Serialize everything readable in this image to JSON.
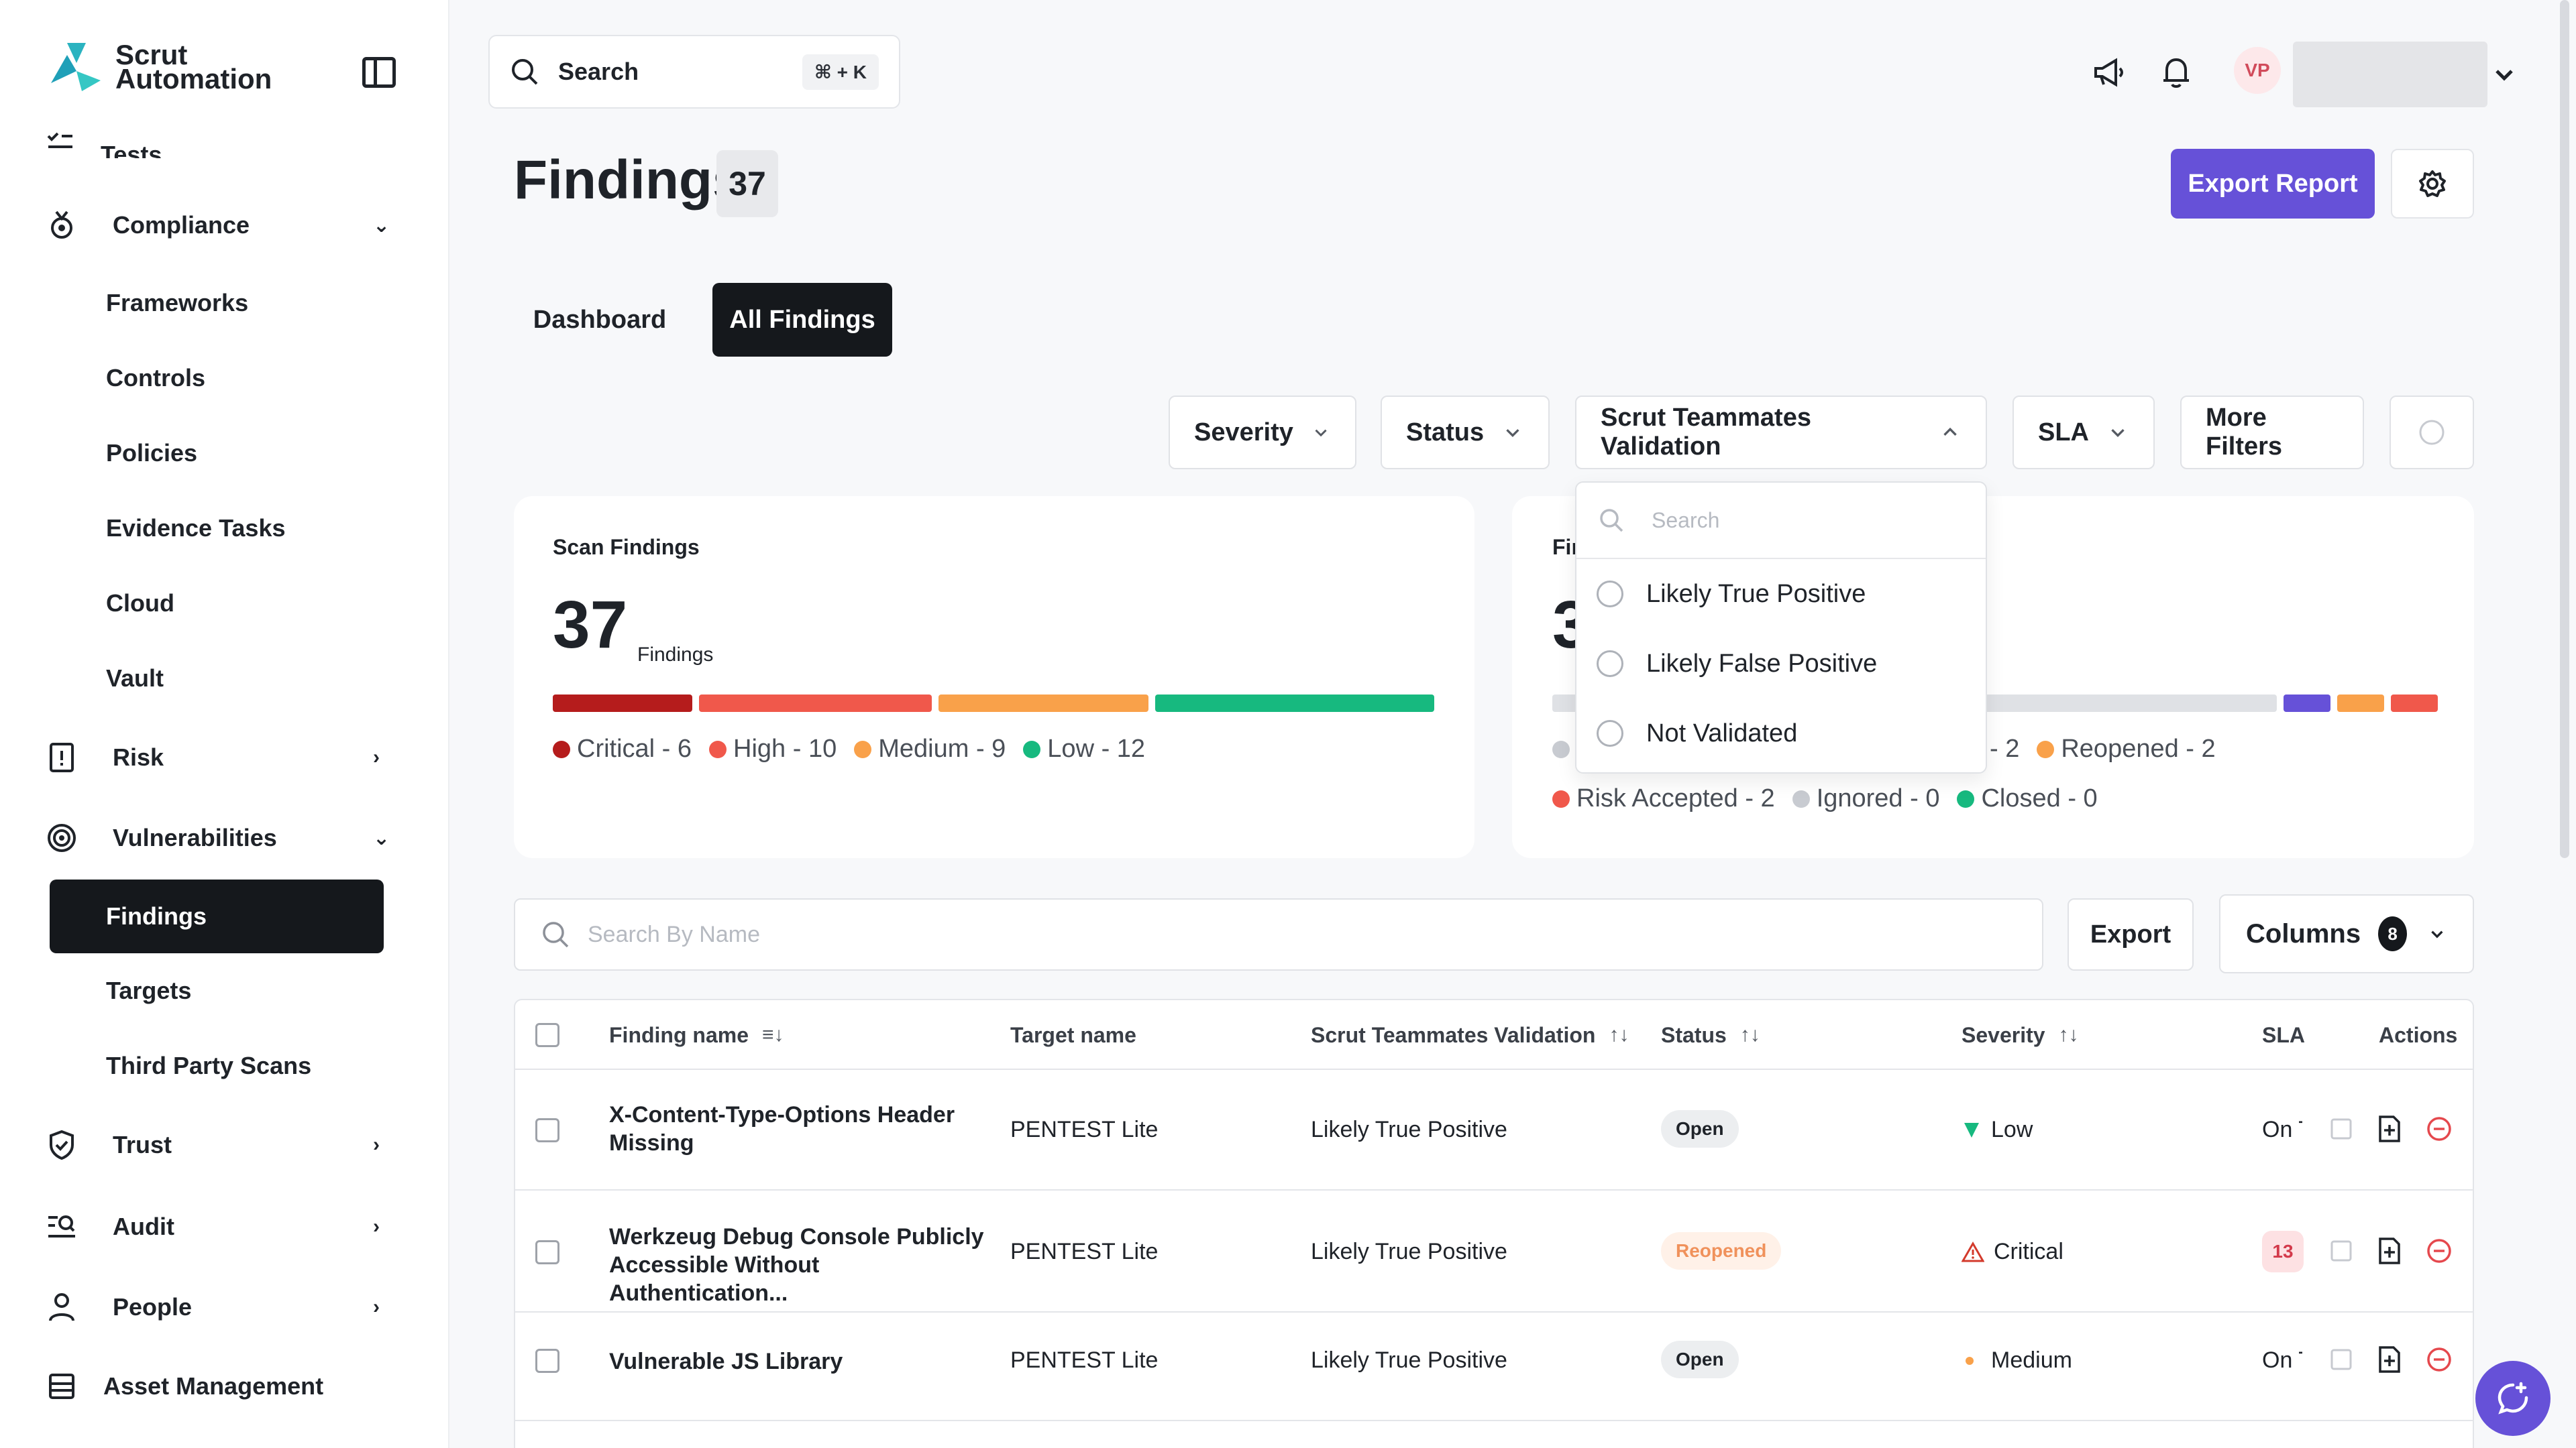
{
  "app": {
    "logo_line1": "Scrut",
    "logo_line2": "Automation"
  },
  "colors": {
    "accent": "#6651d8",
    "dark": "#15181c",
    "critical": "#b51c1c",
    "high": "#f0584b",
    "medium": "#f9a14a",
    "low": "#17b97f",
    "closed": "#17b97f",
    "ignored": "#c8cbd1"
  },
  "sidebar": {
    "tests_label": "Tests",
    "compliance": "Compliance",
    "compliance_items": [
      "Frameworks",
      "Controls",
      "Policies",
      "Evidence Tasks",
      "Cloud",
      "Vault"
    ],
    "risk": "Risk",
    "vulnerabilities": "Vulnerabilities",
    "vulnerabilities_items": [
      "Findings",
      "Targets",
      "Third Party Scans"
    ],
    "trust": "Trust",
    "audit": "Audit",
    "people": "People",
    "asset_management": "Asset Management"
  },
  "topbar": {
    "search_label": "Search",
    "search_shortcut": "⌘ + K",
    "avatar_initials": "VP"
  },
  "header": {
    "title": "Findings",
    "count": "37",
    "export_report": "Export Report"
  },
  "tabs": [
    "Dashboard",
    "All Findings"
  ],
  "filters": [
    "Severity",
    "Status",
    "Scrut Teammates Validation",
    "SLA",
    "More Filters"
  ],
  "scan_card": {
    "title": "Scan Findings",
    "count": "37",
    "count_label": "Findings",
    "segments": [
      {
        "label": "Critical - 6",
        "value": 6,
        "color": "#b51c1c"
      },
      {
        "label": "High - 10",
        "value": 10,
        "color": "#f0584b"
      },
      {
        "label": "Medium - 9",
        "value": 9,
        "color": "#f9a14a"
      },
      {
        "label": "Low - 12",
        "value": 12,
        "color": "#17b97f"
      }
    ]
  },
  "status_card": {
    "title_partial": "Fir",
    "count_partial": "3",
    "legend_row1": [
      "- 2",
      "Reopened - 2"
    ],
    "legend_row2": [
      "Risk Accepted - 2",
      "Ignored - 0",
      "Closed - 0"
    ]
  },
  "dropdown": {
    "search_placeholder": "Search",
    "options": [
      "Likely True Positive",
      "Likely False Positive",
      "Not Validated"
    ]
  },
  "table_toolbar": {
    "search_placeholder": "Search By Name",
    "export": "Export",
    "columns": "Columns",
    "columns_count": "8"
  },
  "table": {
    "headers": [
      "Finding name",
      "Target name",
      "Scrut Teammates Validation",
      "Status",
      "Severity",
      "SLA",
      "Actions"
    ],
    "rows": [
      {
        "name": "X-Content-Type-Options Header Missing",
        "target": "PENTEST Lite",
        "validation": "Likely True Positive",
        "status": "Open",
        "severity": "Low",
        "sla": "On T"
      },
      {
        "name": "Werkzeug Debug Console Publicly Accessible Without Authentication...",
        "target": "PENTEST Lite",
        "validation": "Likely True Positive",
        "status": "Reopened",
        "severity": "Critical",
        "sla": "13"
      },
      {
        "name": "Vulnerable JS Library",
        "target": "PENTEST Lite",
        "validation": "Likely True Positive",
        "status": "Open",
        "severity": "Medium",
        "sla": "On T"
      }
    ]
  }
}
